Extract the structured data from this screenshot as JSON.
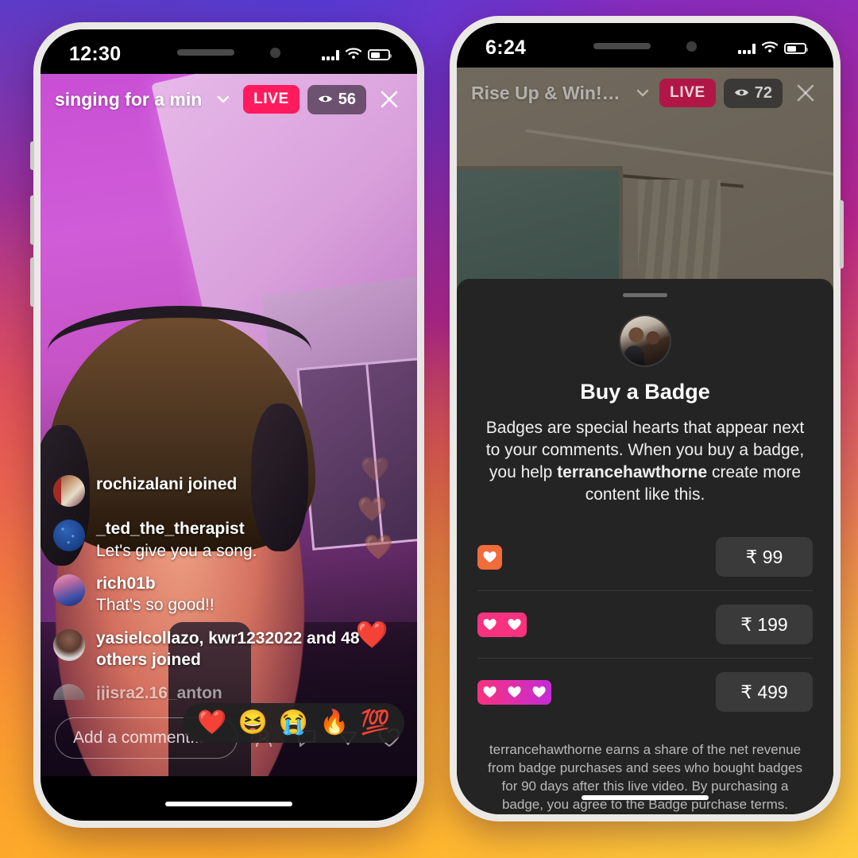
{
  "background": {
    "gradient_colors": [
      "#4a43d8",
      "#8a2fc0",
      "#c62a96",
      "#e42a63",
      "#f5623a",
      "#fba62f",
      "#fcce4d"
    ]
  },
  "phones": [
    {
      "id": "left",
      "status_bar": {
        "time": "12:30",
        "cellular_icon": "cellular-icon",
        "wifi_icon": "wifi-icon",
        "battery_icon": "battery-icon"
      },
      "live_header": {
        "title": "singing for a min",
        "chevron_icon": "chevron-down-icon",
        "live_label": "LIVE",
        "viewers_count": "56",
        "viewers_icon": "eye-icon",
        "close_icon": "close-icon",
        "live_badge_color": "#FF1B5E"
      },
      "comments": [
        {
          "avatar": "avatar-rochizalani",
          "user": "rochizalani joined",
          "text": "",
          "type": "joined"
        },
        {
          "avatar": "avatar-ted-the-therapist",
          "user": "_ted_the_therapist",
          "text": "Let's give you a song.",
          "type": "comment"
        },
        {
          "avatar": "avatar-rich01b",
          "user": "rich01b",
          "text": "That's so good!!",
          "type": "comment"
        },
        {
          "avatar": "avatar-yasielcollazo",
          "user": "yasielcollazo, kwr1232022 and 48 others joined",
          "text": "",
          "type": "joined"
        },
        {
          "avatar": "avatar-jjisra216",
          "user": "jjisra2.16_anton",
          "text": "",
          "type": "joined"
        }
      ],
      "floating_hearts": [
        "🤎",
        "🤎",
        "🤎",
        "❤️"
      ],
      "bottom_bar": {
        "comment_placeholder": "Add a comment...",
        "actions": [
          "user-add-icon",
          "comment-icon",
          "send-icon",
          "heart-icon"
        ]
      },
      "emoji_tray": [
        "❤️",
        "😆",
        "😭",
        "🔥",
        "💯"
      ]
    },
    {
      "id": "right",
      "status_bar": {
        "time": "6:24",
        "cellular_icon": "cellular-icon",
        "wifi_icon": "wifi-icon",
        "battery_icon": "battery-icon"
      },
      "live_header": {
        "title": "Rise Up & Win!!! Tr...",
        "chevron_icon": "chevron-down-icon",
        "live_label": "LIVE",
        "viewers_count": "72",
        "viewers_icon": "eye-icon",
        "close_icon": "close-icon",
        "live_badge_color": "#b01747"
      },
      "badge_sheet": {
        "handle": "drag-handle",
        "avatar": "creator-avatar",
        "title": "Buy a Badge",
        "description_part1": "Badges are special hearts that appear next to your comments. When you buy a badge, you help ",
        "description_username": "terrancehawthorne",
        "description_part2": " create more content like this.",
        "tiers": [
          {
            "hearts": 1,
            "color": "#F26B3A",
            "price": "₹ 99"
          },
          {
            "hearts": 2,
            "color": "#F8327E",
            "price": "₹ 199"
          },
          {
            "hearts": 3,
            "color": "#C42CD6",
            "price": "₹ 499"
          }
        ],
        "footer": "terrancehawthorne earns a share of the net revenue from badge purchases and sees who bought badges for 90 days after this live video. By purchasing a badge, you agree to the Badge purchase terms."
      }
    }
  ]
}
